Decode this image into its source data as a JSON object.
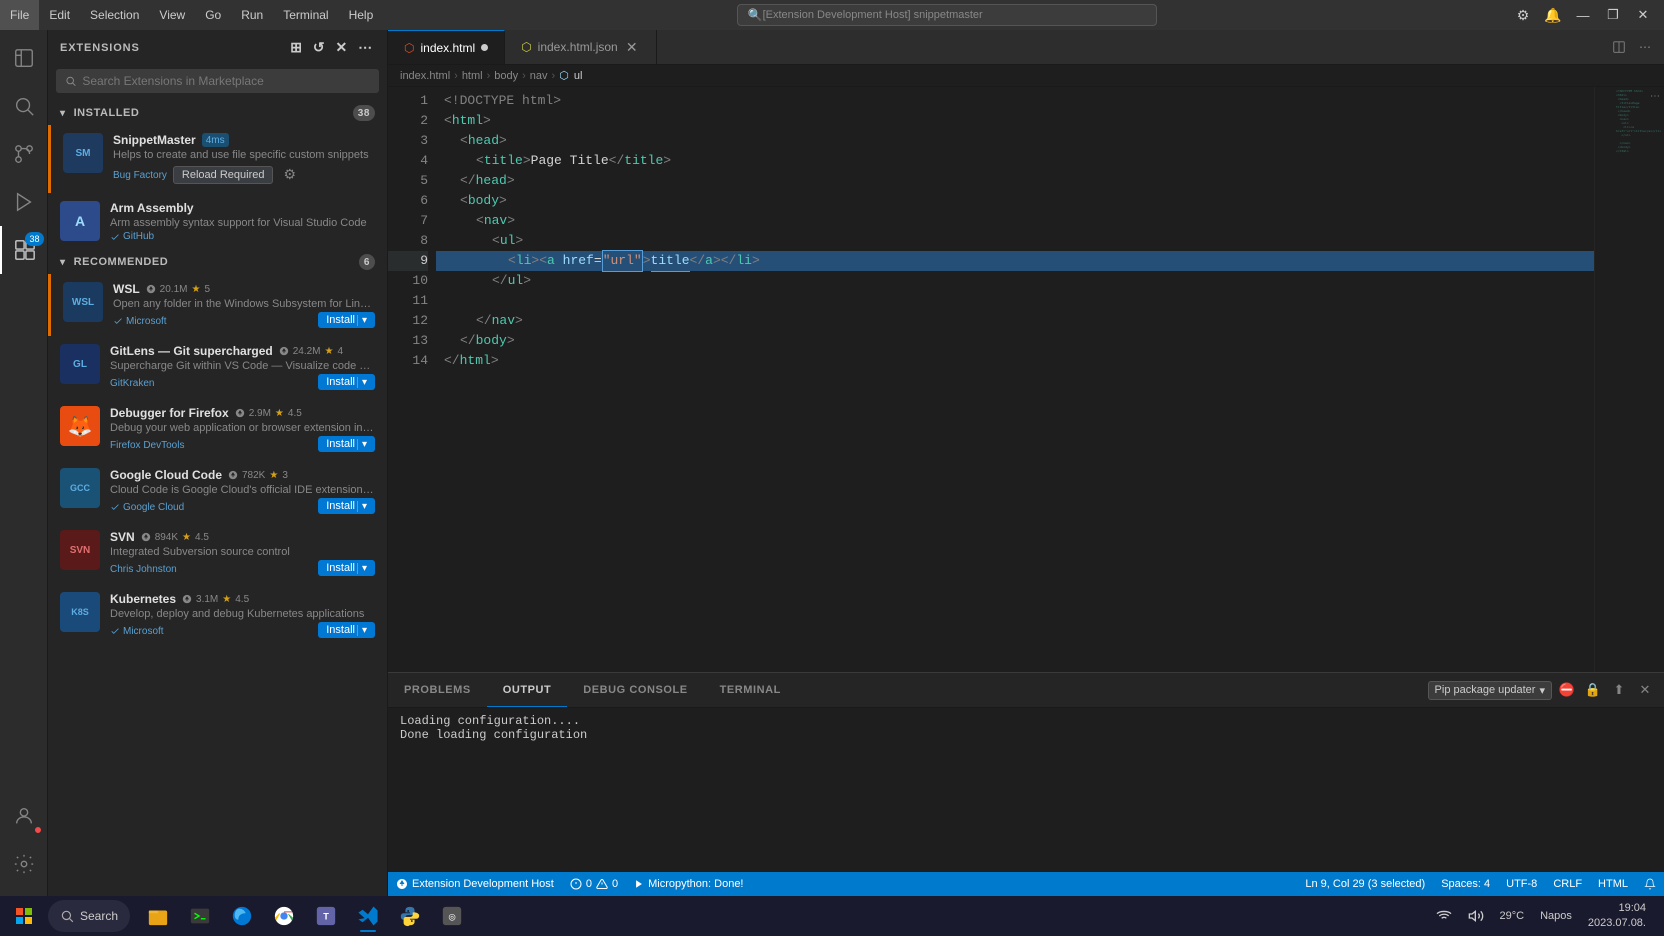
{
  "titlebar": {
    "menu_items": [
      "File",
      "Edit",
      "Selection",
      "View",
      "Go",
      "Run",
      "Terminal",
      "Help"
    ],
    "search_text": "[Extension Development Host] snippetmaster",
    "btns": [
      "◻",
      "❐",
      "—",
      "✕"
    ]
  },
  "activity_bar": {
    "icons": [
      {
        "name": "explorer-icon",
        "symbol": "⎘",
        "active": false
      },
      {
        "name": "search-icon",
        "symbol": "🔍",
        "active": false
      },
      {
        "name": "source-control-icon",
        "symbol": "⑂",
        "active": false
      },
      {
        "name": "run-icon",
        "symbol": "▶",
        "active": false
      },
      {
        "name": "extensions-icon",
        "symbol": "⊞",
        "active": true,
        "badge": "38"
      },
      {
        "name": "remote-icon",
        "symbol": "⚡",
        "active": false
      }
    ],
    "bottom_icons": [
      {
        "name": "accounts-icon",
        "symbol": "👤"
      },
      {
        "name": "settings-icon",
        "symbol": "⚙"
      }
    ]
  },
  "sidebar": {
    "title": "Extensions",
    "search_placeholder": "Search Extensions in Marketplace",
    "sections": {
      "installed": {
        "label": "Installed",
        "badge": "38",
        "extensions": [
          {
            "name": "SnippetMaster",
            "icon_color": "#1e3a5f",
            "icon_text": "SM",
            "meta_downloads": "4ms",
            "description": "Helps to create and use file specific custom snippets",
            "publisher": "Bug Factory",
            "publisher_verified": false,
            "actions": [
              "reload",
              "settings"
            ],
            "reload_label": "Reload Required",
            "settings_icon": "⚙"
          },
          {
            "name": "Arm Assembly",
            "icon_color": "#2d4a8a",
            "icon_text": "A",
            "description": "Arm assembly syntax support for Visual Studio Code",
            "publisher": "GitHub",
            "publisher_verified": false,
            "actions": []
          }
        ]
      },
      "recommended": {
        "label": "Recommended",
        "badge": "6",
        "extensions": [
          {
            "name": "WSL",
            "icon_color": "#1a3a5f",
            "icon_text": "WSL",
            "meta_downloads": "20.1M",
            "meta_rating": "5",
            "description": "Open any folder in the Windows Subsystem for Linux and ...",
            "publisher": "Microsoft",
            "publisher_verified": true,
            "actions": [
              "install"
            ]
          },
          {
            "name": "GitLens — Git supercharged",
            "icon_color": "#1a3060",
            "icon_text": "GL",
            "meta_downloads": "24.2M",
            "meta_rating": "4",
            "description": "Supercharge Git within VS Code — Visualize code authorship ...",
            "publisher": "GitKraken",
            "publisher_verified": false,
            "actions": [
              "install"
            ]
          },
          {
            "name": "Debugger for Firefox",
            "icon_color": "#e84c10",
            "icon_text": "🦊",
            "meta_downloads": "2.9M",
            "meta_rating": "4.5",
            "description": "Debug your web application or browser extension in Firefox",
            "publisher": "Firefox DevTools",
            "publisher_verified": false,
            "actions": [
              "install"
            ]
          },
          {
            "name": "Google Cloud Code",
            "icon_color": "#1a5276",
            "icon_text": "GCC",
            "meta_downloads": "782K",
            "meta_rating": "3",
            "description": "Cloud Code is Google Cloud's official IDE extension to develo...",
            "publisher": "Google Cloud",
            "publisher_verified": true,
            "actions": [
              "install"
            ]
          },
          {
            "name": "SVN",
            "icon_color": "#5a1a1a",
            "icon_text": "SVN",
            "meta_downloads": "894K",
            "meta_rating": "4.5",
            "description": "Integrated Subversion source control",
            "publisher": "Chris Johnston",
            "publisher_verified": false,
            "actions": [
              "install"
            ]
          },
          {
            "name": "Kubernetes",
            "icon_color": "#1a4a7a",
            "icon_text": "K8S",
            "meta_downloads": "3.1M",
            "meta_rating": "4.5",
            "description": "Develop, deploy and debug Kubernetes applications",
            "publisher": "Microsoft",
            "publisher_verified": true,
            "actions": [
              "install"
            ]
          }
        ]
      }
    }
  },
  "tabs": [
    {
      "id": "index-html",
      "label": "index.html",
      "modified": true,
      "active": true
    },
    {
      "id": "index-json",
      "label": "index.html.json",
      "modified": false,
      "active": false
    }
  ],
  "breadcrumb": {
    "items": [
      "index.html",
      "html",
      "body",
      "nav",
      "ul"
    ]
  },
  "editor": {
    "lines": [
      {
        "num": 1,
        "tokens": [
          {
            "t": "doctype",
            "v": "<!DOCTYPE html>"
          }
        ]
      },
      {
        "num": 2,
        "tokens": [
          {
            "t": "bracket",
            "v": "<"
          },
          {
            "t": "tag",
            "v": "html"
          },
          {
            "t": "bracket",
            "v": ">"
          }
        ]
      },
      {
        "num": 3,
        "tokens": [
          {
            "t": "indent",
            "n": 1
          },
          {
            "t": "bracket",
            "v": "<"
          },
          {
            "t": "tag",
            "v": "head"
          },
          {
            "t": "bracket",
            "v": ">"
          }
        ]
      },
      {
        "num": 4,
        "tokens": [
          {
            "t": "indent",
            "n": 2
          },
          {
            "t": "bracket",
            "v": "<"
          },
          {
            "t": "tag",
            "v": "title"
          },
          {
            "t": "bracket",
            "v": ">"
          },
          {
            "t": "text",
            "v": "Page Title"
          },
          {
            "t": "bracket",
            "v": "</"
          },
          {
            "t": "tag",
            "v": "title"
          },
          {
            "t": "bracket",
            "v": ">"
          }
        ]
      },
      {
        "num": 5,
        "tokens": [
          {
            "t": "indent",
            "n": 1
          },
          {
            "t": "bracket",
            "v": "</"
          },
          {
            "t": "tag",
            "v": "head"
          },
          {
            "t": "bracket",
            "v": ">"
          }
        ]
      },
      {
        "num": 6,
        "tokens": [
          {
            "t": "indent",
            "n": 1
          },
          {
            "t": "bracket",
            "v": "<"
          },
          {
            "t": "tag",
            "v": "body"
          },
          {
            "t": "bracket",
            "v": ">"
          }
        ]
      },
      {
        "num": 7,
        "tokens": [
          {
            "t": "indent",
            "n": 2
          },
          {
            "t": "bracket",
            "v": "<"
          },
          {
            "t": "tag",
            "v": "nav"
          },
          {
            "t": "bracket",
            "v": ">"
          }
        ]
      },
      {
        "num": 8,
        "tokens": [
          {
            "t": "indent",
            "n": 3
          },
          {
            "t": "bracket",
            "v": "<"
          },
          {
            "t": "tag",
            "v": "ul"
          },
          {
            "t": "bracket",
            "v": ">"
          }
        ]
      },
      {
        "num": 9,
        "selected": true,
        "tokens": [
          {
            "t": "indent",
            "n": 4
          },
          {
            "t": "bracket",
            "v": "<"
          },
          {
            "t": "tag",
            "v": "li"
          },
          {
            "t": "bracket",
            "v": "><"
          },
          {
            "t": "tag",
            "v": "a"
          },
          {
            "t": "text",
            "v": " "
          },
          {
            "t": "attr",
            "v": "href"
          },
          {
            "t": "eq",
            "v": "="
          },
          {
            "t": "str_sel",
            "v": "\"url\""
          },
          {
            "t": "bracket",
            "v": ">"
          },
          {
            "t": "attr_sel",
            "v": "title"
          },
          {
            "t": "bracket",
            "v": "</"
          },
          {
            "t": "tag",
            "v": "a"
          },
          {
            "t": "bracket",
            "v": "></"
          },
          {
            "t": "tag",
            "v": "li"
          },
          {
            "t": "bracket",
            "v": ">"
          }
        ]
      },
      {
        "num": 10,
        "tokens": [
          {
            "t": "indent",
            "n": 3
          },
          {
            "t": "bracket",
            "v": "</"
          },
          {
            "t": "tag",
            "v": "ul"
          },
          {
            "t": "bracket",
            "v": ">"
          }
        ]
      },
      {
        "num": 11,
        "tokens": []
      },
      {
        "num": 12,
        "tokens": [
          {
            "t": "indent",
            "n": 2
          },
          {
            "t": "bracket",
            "v": "</"
          },
          {
            "t": "tag",
            "v": "nav"
          },
          {
            "t": "bracket",
            "v": ">"
          }
        ]
      },
      {
        "num": 13,
        "tokens": [
          {
            "t": "indent",
            "n": 1
          },
          {
            "t": "bracket",
            "v": "</"
          },
          {
            "t": "tag",
            "v": "body"
          },
          {
            "t": "bracket",
            "v": ">"
          }
        ]
      },
      {
        "num": 14,
        "tokens": [
          {
            "t": "bracket",
            "v": "</"
          },
          {
            "t": "tag",
            "v": "html"
          },
          {
            "t": "bracket",
            "v": ">"
          }
        ]
      }
    ]
  },
  "panel": {
    "tabs": [
      "PROBLEMS",
      "OUTPUT",
      "DEBUG CONSOLE",
      "TERMINAL"
    ],
    "active_tab": "OUTPUT",
    "output_dropdown": "Pip package updater",
    "output_lines": [
      "Loading configuration....",
      "Done loading configuration"
    ]
  },
  "status_bar": {
    "remote": "⎘ Extension Development Host",
    "errors": "0",
    "warnings": "0",
    "branch": "Micropython: Done!",
    "position": "Ln 9, Col 29 (3 selected)",
    "spaces": "Spaces: 4",
    "encoding": "UTF-8",
    "line_endings": "CRLF",
    "language": "HTML",
    "temperature": "29°C",
    "location": "Napos"
  },
  "taskbar": {
    "search_label": "Search",
    "apps": [
      {
        "name": "windows-start",
        "symbol": "⊞"
      },
      {
        "name": "file-explorer",
        "symbol": "📁"
      },
      {
        "name": "terminal-app",
        "symbol": "⬛"
      },
      {
        "name": "browser-edge",
        "symbol": "🌐"
      },
      {
        "name": "browser-chrome",
        "symbol": "●"
      },
      {
        "name": "browser-firefox",
        "symbol": "🦊"
      },
      {
        "name": "messaging",
        "symbol": "💬"
      },
      {
        "name": "vscode-app",
        "symbol": "◈",
        "active": true
      },
      {
        "name": "python-app",
        "symbol": "🐍"
      }
    ],
    "time": "19:04",
    "date": "2023.07.08."
  }
}
